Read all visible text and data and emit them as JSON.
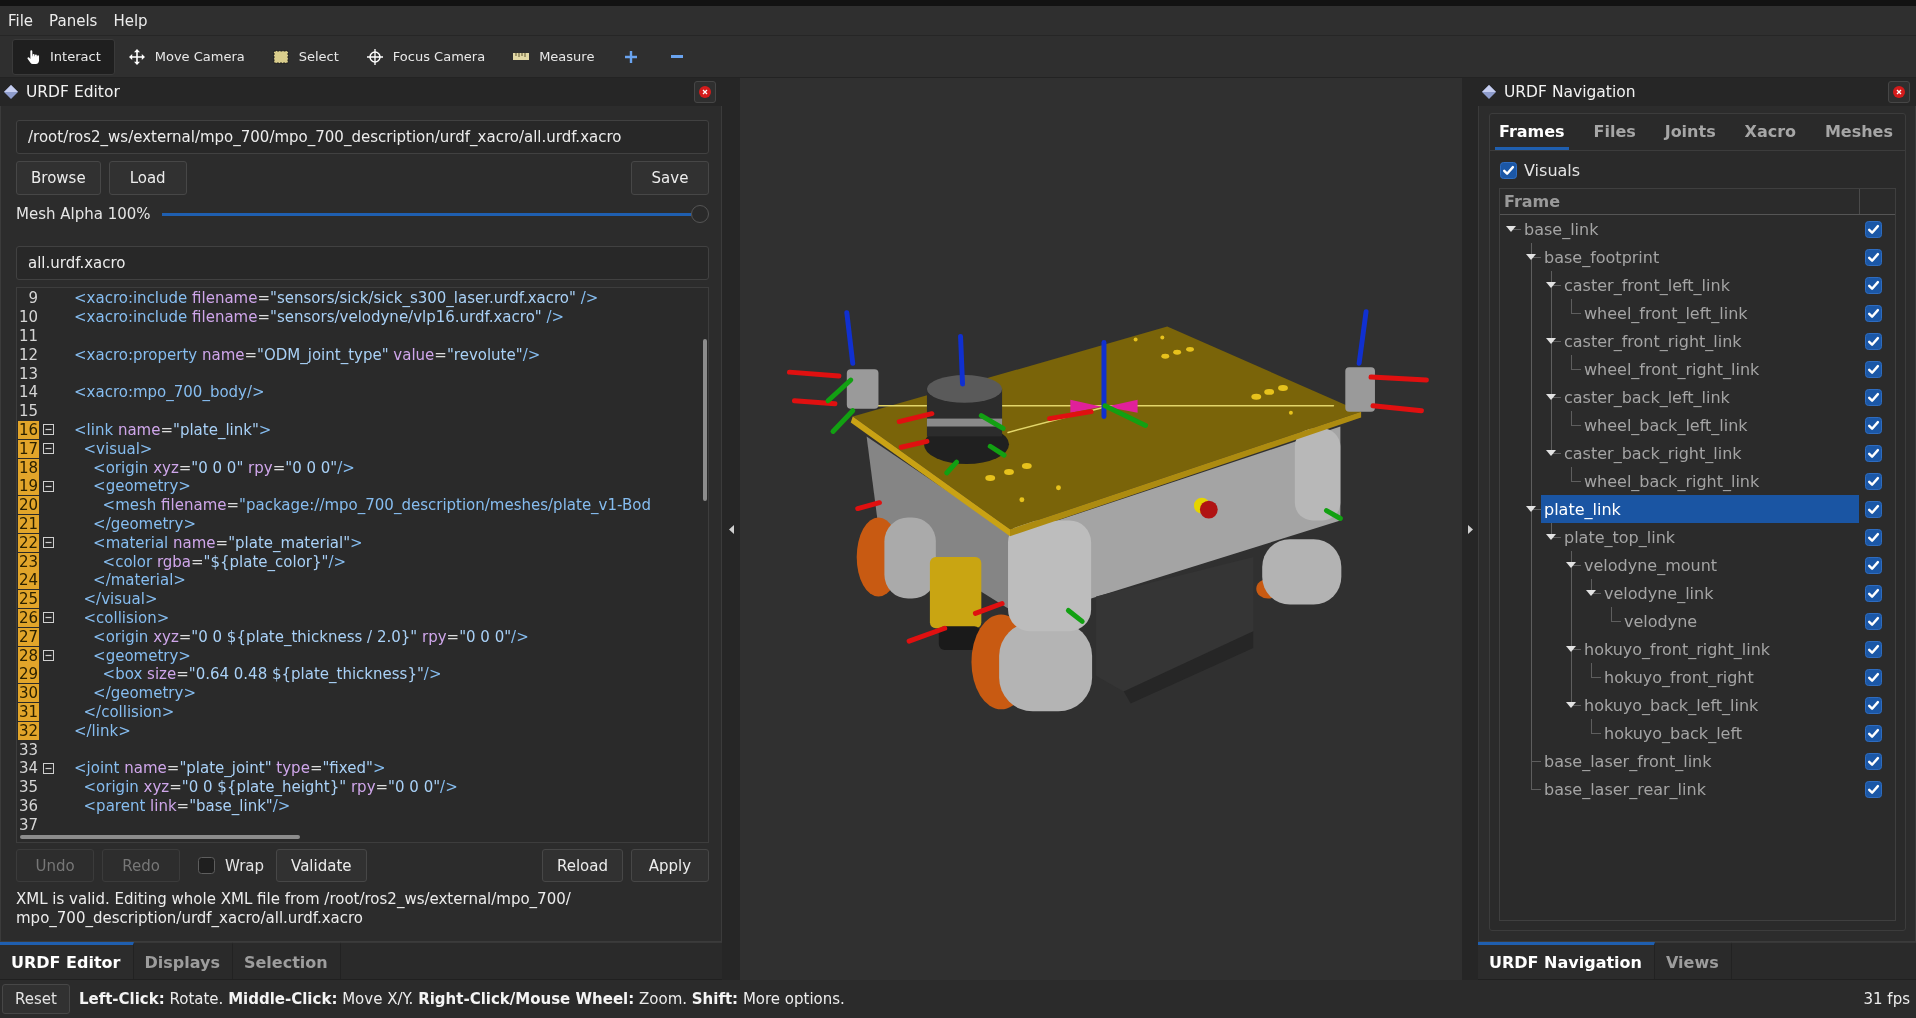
{
  "menu": [
    "File",
    "Panels",
    "Help"
  ],
  "toolbar": {
    "tools": [
      {
        "label": "Interact",
        "selected": true
      },
      {
        "label": "Move Camera",
        "selected": false
      },
      {
        "label": "Select",
        "selected": false
      },
      {
        "label": "Focus Camera",
        "selected": false
      },
      {
        "label": "Measure",
        "selected": false
      }
    ]
  },
  "editor_panel": {
    "title": "URDF Editor",
    "path_field": {
      "value": "/root/ros2_ws/external/mpo_700/mpo_700_description/urdf_xacro/all.urdf.xacro"
    },
    "file_buttons": [
      "Browse",
      "Load"
    ],
    "save_button": "Save",
    "mesh_alpha": {
      "label": "Mesh Alpha 100%",
      "level": 1
    },
    "file_name_field": {
      "value": "all.urdf.xacro"
    },
    "code": {
      "lines": [
        {
          "number": "9",
          "text": "<xacro:include filename=\"sensors/sick/sick_s300_laser.urdf.xacro\" />",
          "highlighted": false,
          "foldable": false
        },
        {
          "number": "10",
          "text": "<xacro:include filename=\"sensors/velodyne/vlp16.urdf.xacro\" />",
          "highlighted": false,
          "foldable": false
        },
        {
          "number": "11",
          "highlighted": false,
          "foldable": false
        },
        {
          "number": "12",
          "text": "<xacro:property name=\"ODM_joint_type\" value=\"revolute\"/>",
          "highlighted": false,
          "foldable": false
        },
        {
          "number": "13",
          "highlighted": false,
          "foldable": false
        },
        {
          "number": "14",
          "text": "<xacro:mpo_700_body/>",
          "highlighted": false,
          "foldable": false
        },
        {
          "number": "15",
          "highlighted": false,
          "foldable": false
        },
        {
          "number": "16",
          "text": "<link name=\"plate_link\">",
          "highlighted": true,
          "foldable": true
        },
        {
          "number": "17",
          "text": "  <visual>",
          "highlighted": true,
          "foldable": true
        },
        {
          "number": "18",
          "text": "    <origin xyz=\"0 0 0\" rpy=\"0 0 0\"/>",
          "highlighted": true,
          "foldable": false
        },
        {
          "number": "19",
          "text": "    <geometry>",
          "highlighted": true,
          "foldable": true
        },
        {
          "number": "20",
          "text": "      <mesh filename=\"package://mpo_700_description/meshes/plate_v1-Bod",
          "highlighted": true,
          "foldable": false
        },
        {
          "number": "21",
          "text": "    </geometry>",
          "highlighted": true,
          "foldable": false
        },
        {
          "number": "22",
          "text": "    <material name=\"plate_material\">",
          "highlighted": true,
          "foldable": true
        },
        {
          "number": "23",
          "text": "      <color rgba=\"${plate_color}\"/>",
          "highlighted": true,
          "foldable": false
        },
        {
          "number": "24",
          "text": "    </material>",
          "highlighted": true,
          "foldable": false
        },
        {
          "number": "25",
          "text": "  </visual>",
          "highlighted": true,
          "foldable": false
        },
        {
          "number": "26",
          "text": "  <collision>",
          "highlighted": true,
          "foldable": true
        },
        {
          "number": "27",
          "text": "    <origin xyz=\"0 0 ${plate_thickness / 2.0}\" rpy=\"0 0 0\"/>",
          "highlighted": true,
          "foldable": false
        },
        {
          "number": "28",
          "text": "    <geometry>",
          "highlighted": true,
          "foldable": true
        },
        {
          "number": "29",
          "text": "      <box size=\"0.64 0.48 ${plate_thickness}\"/>",
          "highlighted": true,
          "foldable": false
        },
        {
          "number": "30",
          "text": "    </geometry>",
          "highlighted": true,
          "foldable": false
        },
        {
          "number": "31",
          "text": "  </collision>",
          "highlighted": true,
          "foldable": false
        },
        {
          "number": "32",
          "text": "</link>",
          "highlighted": true,
          "foldable": false
        },
        {
          "number": "33",
          "highlighted": false,
          "foldable": false
        },
        {
          "number": "34",
          "text": "<joint name=\"plate_joint\" type=\"fixed\">",
          "highlighted": false,
          "foldable": true
        },
        {
          "number": "35",
          "text": "  <origin xyz=\"0 0 ${plate_height}\" rpy=\"0 0 0\"/>",
          "highlighted": false,
          "foldable": false
        },
        {
          "number": "36",
          "text": "  <parent link=\"base_link\"/>",
          "highlighted": false,
          "foldable": false
        },
        {
          "number": "37",
          "highlighted": false,
          "foldable": false
        }
      ]
    },
    "edit_buttons": [
      {
        "label": "Undo",
        "disabled": true
      },
      {
        "label": "Redo",
        "disabled": true
      }
    ],
    "wrap": {
      "label": "Wrap",
      "checked": false
    },
    "validate_button": "Validate",
    "action_buttons": [
      "Reload",
      "Apply"
    ],
    "message": "XML is valid. Editing whole XML file from /root/ros2_ws/external/mpo_700/mpo_700_description/urdf_xacro/all.urdf.xacro"
  },
  "left_dock_tabs": [
    {
      "label": "URDF Editor",
      "selected": true
    },
    {
      "label": "Displays",
      "selected": false
    },
    {
      "label": "Selection",
      "selected": false
    }
  ],
  "nav_panel": {
    "title": "URDF Navigation",
    "tabs": [
      {
        "label": "Frames",
        "selected": true
      },
      {
        "label": "Files",
        "selected": false
      },
      {
        "label": "Joints",
        "selected": false
      },
      {
        "label": "Xacro",
        "selected": false
      },
      {
        "label": "Meshes",
        "selected": false
      }
    ],
    "visuals": {
      "label": "Visuals",
      "checked": true
    },
    "tree": {
      "columns": [
        "Frame"
      ],
      "items": [
        {
          "label": "base_link",
          "expanded": true,
          "selected": false,
          "checked": true,
          "children": [
            {
              "label": "base_footprint",
              "expanded": true,
              "selected": false,
              "checked": true,
              "children": [
                {
                  "label": "caster_front_left_link",
                  "expanded": true,
                  "selected": false,
                  "checked": true,
                  "children": [
                    {
                      "label": "wheel_front_left_link",
                      "selected": false,
                      "checked": true
                    }
                  ]
                },
                {
                  "label": "caster_front_right_link",
                  "expanded": true,
                  "selected": false,
                  "checked": true,
                  "children": [
                    {
                      "label": "wheel_front_right_link",
                      "selected": false,
                      "checked": true
                    }
                  ]
                },
                {
                  "label": "caster_back_left_link",
                  "expanded": true,
                  "selected": false,
                  "checked": true,
                  "children": [
                    {
                      "label": "wheel_back_left_link",
                      "selected": false,
                      "checked": true
                    }
                  ]
                },
                {
                  "label": "caster_back_right_link",
                  "expanded": true,
                  "selected": false,
                  "checked": true,
                  "children": [
                    {
                      "label": "wheel_back_right_link",
                      "selected": false,
                      "checked": true
                    }
                  ]
                }
              ]
            },
            {
              "label": "plate_link",
              "expanded": true,
              "selected": true,
              "checked": true,
              "children": [
                {
                  "label": "plate_top_link",
                  "expanded": true,
                  "selected": false,
                  "checked": true,
                  "children": [
                    {
                      "label": "velodyne_mount",
                      "expanded": true,
                      "selected": false,
                      "checked": true,
                      "children": [
                        {
                          "label": "velodyne_link",
                          "expanded": true,
                          "selected": false,
                          "checked": true,
                          "children": [
                            {
                              "label": "velodyne",
                              "selected": false,
                              "checked": true
                            }
                          ]
                        }
                      ]
                    },
                    {
                      "label": "hokuyo_front_right_link",
                      "expanded": true,
                      "selected": false,
                      "checked": true,
                      "children": [
                        {
                          "label": "hokuyo_front_right",
                          "selected": false,
                          "checked": true
                        }
                      ]
                    },
                    {
                      "label": "hokuyo_back_left_link",
                      "expanded": true,
                      "selected": false,
                      "checked": true,
                      "children": [
                        {
                          "label": "hokuyo_back_left",
                          "selected": false,
                          "checked": true
                        }
                      ]
                    }
                  ]
                }
              ]
            },
            {
              "label": "base_laser_front_link",
              "selected": false,
              "checked": true
            },
            {
              "label": "base_laser_rear_link",
              "selected": false,
              "checked": true
            }
          ]
        }
      ]
    }
  },
  "right_dock_tabs": [
    {
      "label": "URDF Navigation",
      "selected": true
    },
    {
      "label": "Views",
      "selected": false
    }
  ],
  "status_bar": {
    "reset_button": "Reset",
    "hint": "**Left-Click:** Rotate. **Middle-Click:** Move X/Y. **Right-Click/Mouse Wheel:** Zoom. **Shift:** More options.",
    "fps": "31 fps"
  }
}
